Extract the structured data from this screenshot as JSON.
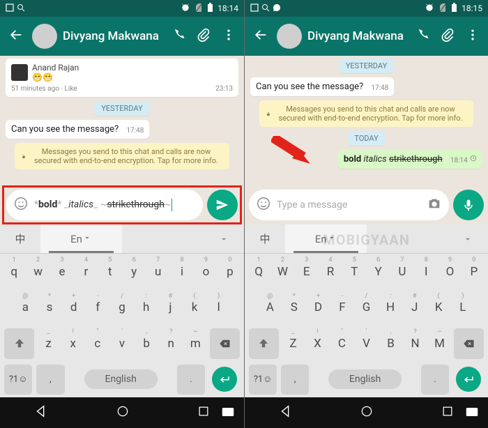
{
  "watermark": "MOBIGYAAN",
  "left": {
    "status": {
      "time": "18:14"
    },
    "contact_name": "Divyang Makwana",
    "old_post": {
      "name": "Anand Rajan",
      "meta": "51 minutes ago",
      "like": "Like",
      "time": "23:13"
    },
    "day1": "YESTERDAY",
    "msg_in": {
      "text": "Can you see the message?",
      "time": "17:48"
    },
    "encryption": "Messages you send to this chat and calls are now secured with end-to-end encryption. Tap for more info.",
    "compose": {
      "bold": "bold",
      "italics": "italics",
      "strike": "strikethrough"
    },
    "kbd": {
      "tab1": "中",
      "tab2": "En",
      "r1": [
        "q",
        "w",
        "e",
        "r",
        "t",
        "y",
        "u",
        "i",
        "o",
        "p"
      ],
      "r1n": [
        "1",
        "2",
        "3",
        "4",
        "5",
        "6",
        "7",
        "8",
        "9",
        "0"
      ],
      "r2": [
        "a",
        "s",
        "d",
        "f",
        "g",
        "h",
        "j",
        "k",
        "l"
      ],
      "r2s": [
        "@",
        "*",
        "+",
        "-",
        "/",
        ":",
        " #",
        "(",
        ")"
      ],
      "r3": [
        "z",
        "x",
        "c",
        "v",
        "b",
        "n",
        "m"
      ],
      "r3s": [
        "_",
        "!",
        "\"",
        "'",
        ",",
        "?",
        "~"
      ],
      "sym": "?1☺",
      "space": "English",
      "comma": ","
    }
  },
  "right": {
    "status": {
      "time": "18:15"
    },
    "contact_name": "Divyang Makwana",
    "day1": "YESTERDAY",
    "msg_in": {
      "text": "Can you see the message?",
      "time": "17:48"
    },
    "encryption": "Messages you send to this chat and calls are now secured with end-to-end encryption. Tap for more info.",
    "day2": "TODAY",
    "msg_out": {
      "bold": "bold",
      "italics": "italics",
      "strike": "strikethrough",
      "time": "18:14"
    },
    "compose_placeholder": "Type a message",
    "kbd": {
      "tab1": "中",
      "tab2": "En",
      "r1": [
        "Q",
        "W",
        "E",
        "R",
        "T",
        "Y",
        "U",
        "I",
        "O",
        "P"
      ],
      "r1n": [
        "1",
        "2",
        "3",
        "4",
        "5",
        "6",
        "7",
        "8",
        "9",
        "0"
      ],
      "r2": [
        "A",
        "S",
        "D",
        "F",
        "G",
        "H",
        "J",
        "K",
        "L"
      ],
      "r2s": [
        "@",
        "*",
        "+",
        "-",
        "/",
        ":",
        " #",
        "(",
        ")"
      ],
      "r3": [
        "Z",
        "X",
        "C",
        "V",
        "B",
        "N",
        "M"
      ],
      "r3s": [
        "_",
        "!",
        "\"",
        "'",
        ",",
        "?",
        "~"
      ],
      "sym": "?1☺",
      "space": "English",
      "comma": ","
    }
  }
}
